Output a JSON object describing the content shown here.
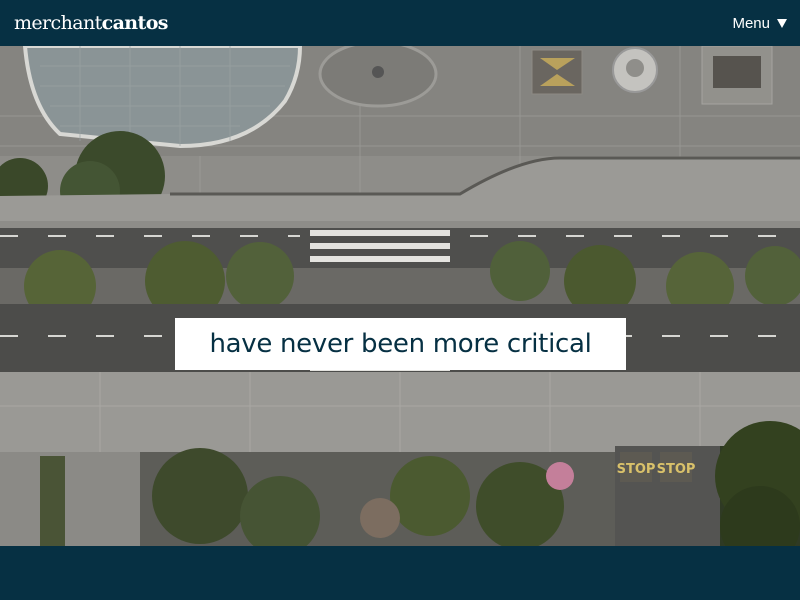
{
  "header": {
    "logo_light": "merchant",
    "logo_bold": "cantos",
    "menu_label": "Menu",
    "menu_icon": "caret-down-icon"
  },
  "hero": {
    "caption": "have never been more critical",
    "road_markings": [
      "STOP",
      "STOP"
    ]
  },
  "colors": {
    "navy": "#063043",
    "caption_bg": "#ffffff"
  }
}
